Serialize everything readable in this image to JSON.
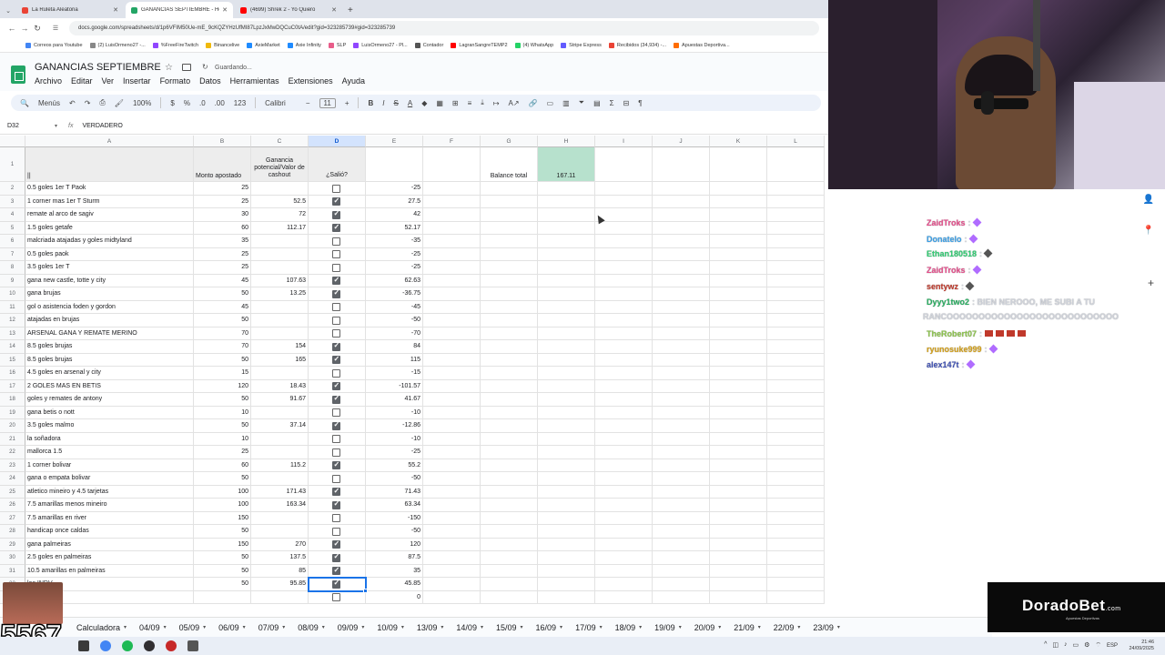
{
  "browser": {
    "tabs": [
      {
        "title": "La Ruleta Aleatoria",
        "favicon_color": "#ea4335"
      },
      {
        "title": "GANANCIAS SEPTIEMBRE - Ho",
        "favicon_color": "#23a566"
      },
      {
        "title": "(4699) Shrek 2 - Yo Quiero",
        "favicon_color": "#ff0000"
      }
    ],
    "url": "docs.google.com/spreadsheets/d/1p6VFIM50Ue-mE_9cKQZYHzUfMI87LpzJxMwDQCuC0tA/edit?gid=323285739#gid=323285739",
    "bookmarks": [
      {
        "label": "Correos para Youtube",
        "color": "#4285f4"
      },
      {
        "label": "(2) LuisOrmeno27 -...",
        "color": "#888888"
      },
      {
        "label": "%FreeFireTwitch",
        "color": "#9146ff"
      },
      {
        "label": "Binancelive",
        "color": "#f0b90b"
      },
      {
        "label": "AxieMarket",
        "color": "#1f8bff"
      },
      {
        "label": "Axie Infinity",
        "color": "#1f8bff"
      },
      {
        "label": "SLP",
        "color": "#e85d8a"
      },
      {
        "label": "LuisOrmeno27 - Pl...",
        "color": "#9146ff"
      },
      {
        "label": "Contador",
        "color": "#555555"
      },
      {
        "label": "LagranSangreTEMP2",
        "color": "#ff0000"
      },
      {
        "label": "(4) WhatsApp",
        "color": "#25d366"
      },
      {
        "label": "Stripe Express",
        "color": "#635bff"
      },
      {
        "label": "Recibidos (34,934) -...",
        "color": "#ea4335"
      },
      {
        "label": "Apuestas Deportiva...",
        "color": "#ff6d00"
      }
    ]
  },
  "sheets": {
    "title": "GANANCIAS SEPTIEMBRE",
    "saving": "Guardando...",
    "menu": [
      "Archivo",
      "Editar",
      "Ver",
      "Insertar",
      "Formato",
      "Datos",
      "Herramientas",
      "Extensiones",
      "Ayuda"
    ],
    "toolbar": {
      "search": "Menús",
      "zoom": "100%",
      "currency": "$",
      "percent": "%",
      "dec_minus": ".0",
      "dec_plus": ".00",
      "number_format": "123",
      "font": "Calibri",
      "font_size": "11"
    },
    "formula_bar": {
      "cell_ref": "D32",
      "fx": "fx",
      "value": "VERDADERO"
    },
    "columns": [
      "A",
      "B",
      "C",
      "D",
      "E",
      "F",
      "G",
      "H",
      "I",
      "J",
      "K",
      "L"
    ],
    "selected_column": "D",
    "header_row": {
      "a": "||",
      "b": "Monto apostado",
      "c": "Ganancia potencial/Valor de cashout",
      "d": "¿Salió?"
    },
    "balance_label": "Balance total",
    "balance_value": "167.11",
    "balance_color": "#b7e1cd",
    "rows": [
      {
        "n": "2",
        "a": "0.5 goles 1er T Paok",
        "b": "25",
        "c": "",
        "d": false,
        "e": "-25"
      },
      {
        "n": "3",
        "a": "1 corner mas 1er T Sturm",
        "b": "25",
        "c": "52.5",
        "d": true,
        "e": "27.5"
      },
      {
        "n": "4",
        "a": "remate al arco de sagiv",
        "b": "30",
        "c": "72",
        "d": true,
        "e": "42"
      },
      {
        "n": "5",
        "a": "1.5 goles getafe",
        "b": "60",
        "c": "112.17",
        "d": true,
        "e": "52.17"
      },
      {
        "n": "6",
        "a": "malcriada atajadas y goles midtyland",
        "b": "35",
        "c": "",
        "d": false,
        "e": "-35"
      },
      {
        "n": "7",
        "a": "0.5 goles paok",
        "b": "25",
        "c": "",
        "d": false,
        "e": "-25"
      },
      {
        "n": "8",
        "a": "3.5 goles 1er T",
        "b": "25",
        "c": "",
        "d": false,
        "e": "-25"
      },
      {
        "n": "9",
        "a": "gana new castle, totte y city",
        "b": "45",
        "c": "107.63",
        "d": true,
        "e": "62.63"
      },
      {
        "n": "10",
        "a": "gana brujas",
        "b": "50",
        "c": "13.25",
        "d": true,
        "e": "-36.75"
      },
      {
        "n": "11",
        "a": "gol o asistencia foden y gordon",
        "b": "45",
        "c": "",
        "d": false,
        "e": "-45"
      },
      {
        "n": "12",
        "a": "atajadas en brujas",
        "b": "50",
        "c": "",
        "d": false,
        "e": "-50"
      },
      {
        "n": "13",
        "a": "ARSENAL GANA Y REMATE MERINO",
        "b": "70",
        "c": "",
        "d": false,
        "e": "-70"
      },
      {
        "n": "14",
        "a": "8.5 goles brujas",
        "b": "70",
        "c": "154",
        "d": true,
        "e": "84"
      },
      {
        "n": "15",
        "a": "8.5 goles brujas",
        "b": "50",
        "c": "165",
        "d": true,
        "e": "115"
      },
      {
        "n": "16",
        "a": "4.5 goles en arsenal y city",
        "b": "15",
        "c": "",
        "d": false,
        "e": "-15"
      },
      {
        "n": "17",
        "a": "2 GOLES MAS EN BETIS",
        "b": "120",
        "c": "18.43",
        "d": true,
        "e": "-101.57"
      },
      {
        "n": "18",
        "a": "goles y remates de antony",
        "b": "50",
        "c": "91.67",
        "d": true,
        "e": "41.67"
      },
      {
        "n": "19",
        "a": "gana betis o nott",
        "b": "10",
        "c": "",
        "d": false,
        "e": "-10"
      },
      {
        "n": "20",
        "a": "3.5 goles malmo",
        "b": "50",
        "c": "37.14",
        "d": true,
        "e": "-12.86"
      },
      {
        "n": "21",
        "a": "la soñadora",
        "b": "10",
        "c": "",
        "d": false,
        "e": "-10"
      },
      {
        "n": "22",
        "a": "mallorca 1.5",
        "b": "25",
        "c": "",
        "d": false,
        "e": "-25"
      },
      {
        "n": "23",
        "a": "1 corner bolivar",
        "b": "60",
        "c": "115.2",
        "d": true,
        "e": "55.2"
      },
      {
        "n": "24",
        "a": "gana o empata bolivar",
        "b": "50",
        "c": "",
        "d": false,
        "e": "-50"
      },
      {
        "n": "25",
        "a": "atletico mineiro y 4.5 tarjetas",
        "b": "100",
        "c": "171.43",
        "d": true,
        "e": "71.43"
      },
      {
        "n": "26",
        "a": "7.5 amarillas menos mineiro",
        "b": "100",
        "c": "163.34",
        "d": true,
        "e": "63.34"
      },
      {
        "n": "27",
        "a": "7.5 amarillas en river",
        "b": "150",
        "c": "",
        "d": false,
        "e": "-150"
      },
      {
        "n": "28",
        "a": "handicap once caldas",
        "b": "50",
        "c": "",
        "d": false,
        "e": "-50"
      },
      {
        "n": "29",
        "a": "gana palmeiras",
        "b": "150",
        "c": "270",
        "d": true,
        "e": "120"
      },
      {
        "n": "30",
        "a": "2.5 goles en palmeiras",
        "b": "50",
        "c": "137.5",
        "d": true,
        "e": "87.5"
      },
      {
        "n": "31",
        "a": "10.5 amarillas en palmeiras",
        "b": "50",
        "c": "85",
        "d": true,
        "e": "35"
      },
      {
        "n": "32",
        "a": "les INDV",
        "b": "50",
        "c": "95.85",
        "d": true,
        "e": "45.85"
      },
      {
        "n": "",
        "a": "",
        "b": "",
        "c": "",
        "d": false,
        "e": "0"
      }
    ],
    "sheet_tabs": [
      "Calculadora",
      "04/09",
      "05/09",
      "06/09",
      "07/09",
      "08/09",
      "09/09",
      "10/09",
      "13/09",
      "14/09",
      "15/09",
      "16/09",
      "17/09",
      "18/09",
      "19/09",
      "20/09",
      "21/09",
      "22/09",
      "23/09"
    ]
  },
  "chat": [
    {
      "user": "ZaidTroks",
      "color": "#e74c8b",
      "msg": ":",
      "badge": "#b06cff"
    },
    {
      "user": "Donatelo",
      "color": "#3aa0e8",
      "msg": ":",
      "badge": "#b06cff"
    },
    {
      "user": "Ethan180518",
      "color": "#2ecc71",
      "msg": ":",
      "badge": "#555555"
    },
    {
      "user": "ZaidTroks",
      "color": "#e74c8b",
      "msg": ":",
      "badge": "#b06cff"
    },
    {
      "user": "sentywz",
      "color": "#c0392b",
      "msg": ":",
      "badge": "#555555"
    },
    {
      "user": "Dyyy1two2",
      "color": "#27ae60",
      "msg": ": BIEN NEROOO, ME SUBI A TU"
    },
    {
      "user": "",
      "color": "#cfd3db",
      "msg": "RANCOOOOOOOOOOOOOOOOOOOOOOOOOOO"
    },
    {
      "user": "TheRobert07",
      "color": "#8bc34a",
      "msg": ":",
      "swords": 4
    },
    {
      "user": "ryunosuke999",
      "color": "#d4a017",
      "msg": ":",
      "badge": "#b06cff"
    },
    {
      "user": "alex147t",
      "color": "#3f51b5",
      "msg": ":",
      "badge": "#b06cff"
    }
  ],
  "sponsor": {
    "name": "DoradoBet",
    "suffix": ".com",
    "tagline": "Apuestas Deportivas"
  },
  "overlay": {
    "counter": "5567"
  },
  "taskbar": {
    "lang": "ESP",
    "time": "21:46",
    "date": "24/09/2025"
  }
}
